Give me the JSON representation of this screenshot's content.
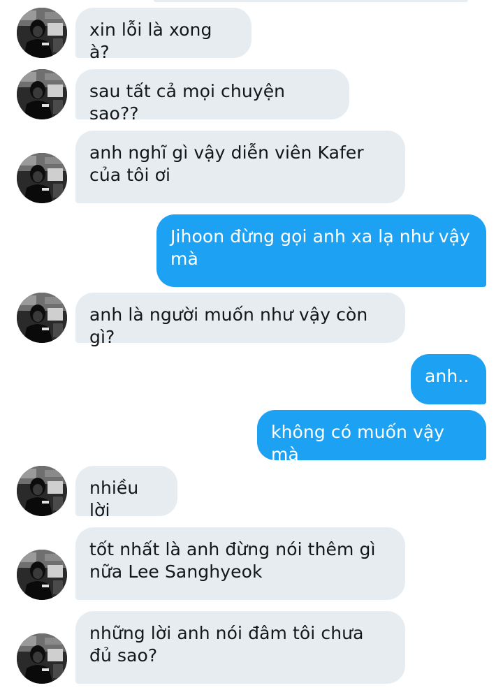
{
  "conversation": {
    "messages": [
      {
        "sender": "other",
        "text": "xin lỗi là xong à?"
      },
      {
        "sender": "other",
        "text": "sau tất cả mọi chuyện sao??"
      },
      {
        "sender": "other",
        "text": "anh nghĩ gì vậy diễn viên Kafer của tôi ơi"
      },
      {
        "sender": "me",
        "text": "Jihoon đừng gọi anh xa lạ như vậy mà"
      },
      {
        "sender": "other",
        "text": "anh là người muốn như vậy còn gì?"
      },
      {
        "sender": "me",
        "text": "anh.."
      },
      {
        "sender": "me",
        "text": "không có muốn vậy mà"
      },
      {
        "sender": "other",
        "text": "nhiều lời"
      },
      {
        "sender": "other",
        "text": "tốt nhất là anh đừng nói thêm gì nữa Lee Sanghyeok"
      },
      {
        "sender": "other",
        "text": "những lời anh nói đâm tôi chưa đủ sao?"
      }
    ]
  },
  "colors": {
    "incoming_bubble": "#e6ecf0",
    "incoming_text": "#14171a",
    "outgoing_bubble": "#1da1f2",
    "outgoing_text": "#ffffff",
    "background": "#ffffff"
  },
  "icons": {
    "avatar": "user-avatar-photo"
  }
}
